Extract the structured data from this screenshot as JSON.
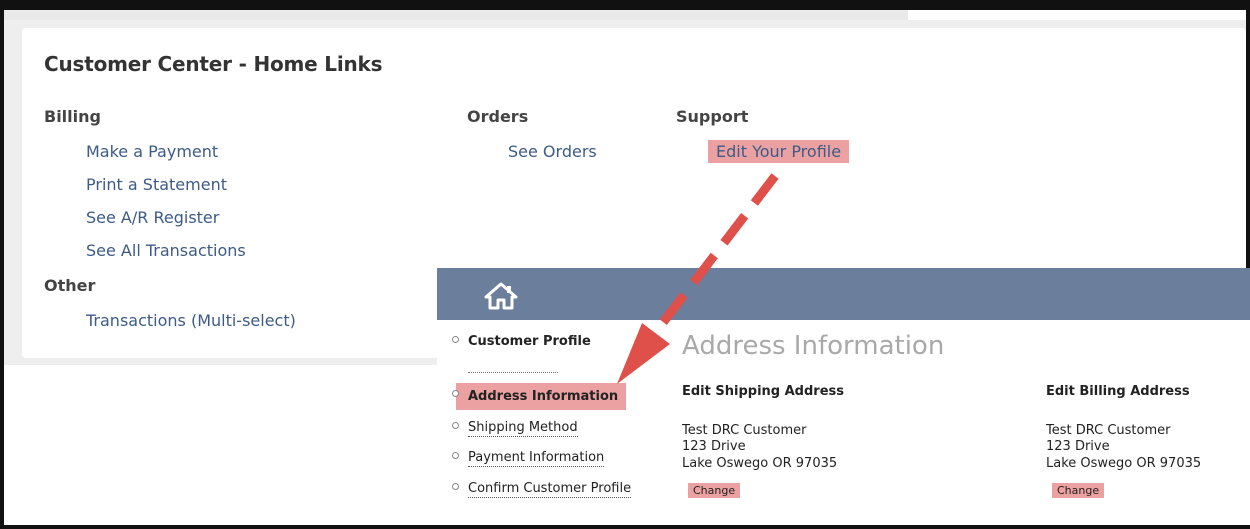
{
  "card": {
    "title": "Customer Center - Home Links",
    "billing": {
      "heading": "Billing",
      "links": [
        "Make a Payment",
        "Print a Statement",
        "See A/R Register",
        "See All Transactions"
      ]
    },
    "other": {
      "heading": "Other",
      "links": [
        "Transactions (Multi-select)"
      ]
    },
    "orders": {
      "heading": "Orders",
      "links": [
        "See Orders"
      ]
    },
    "support": {
      "heading": "Support",
      "links": [
        "Edit Your Profile"
      ]
    }
  },
  "profile": {
    "nav_icon": "home-icon",
    "sidebar": [
      "Customer Profile",
      "Address Information",
      "Shipping Method",
      "Payment Information",
      "Confirm Customer Profile"
    ],
    "section_title": "Address Information",
    "shipping": {
      "heading": "Edit Shipping Address",
      "name": "Test DRC Customer",
      "street": "123 Drive",
      "city": "Lake Oswego OR 97035",
      "change_label": "Change"
    },
    "billing": {
      "heading": "Edit Billing Address",
      "name": "Test DRC Customer",
      "street": "123 Drive",
      "city": "Lake Oswego OR 97035",
      "change_label": "Change"
    }
  },
  "colors": {
    "highlight": "#eba1a1",
    "navbar": "#6b7e9c",
    "link": "#3d5b86",
    "arrow": "#e0504a"
  }
}
